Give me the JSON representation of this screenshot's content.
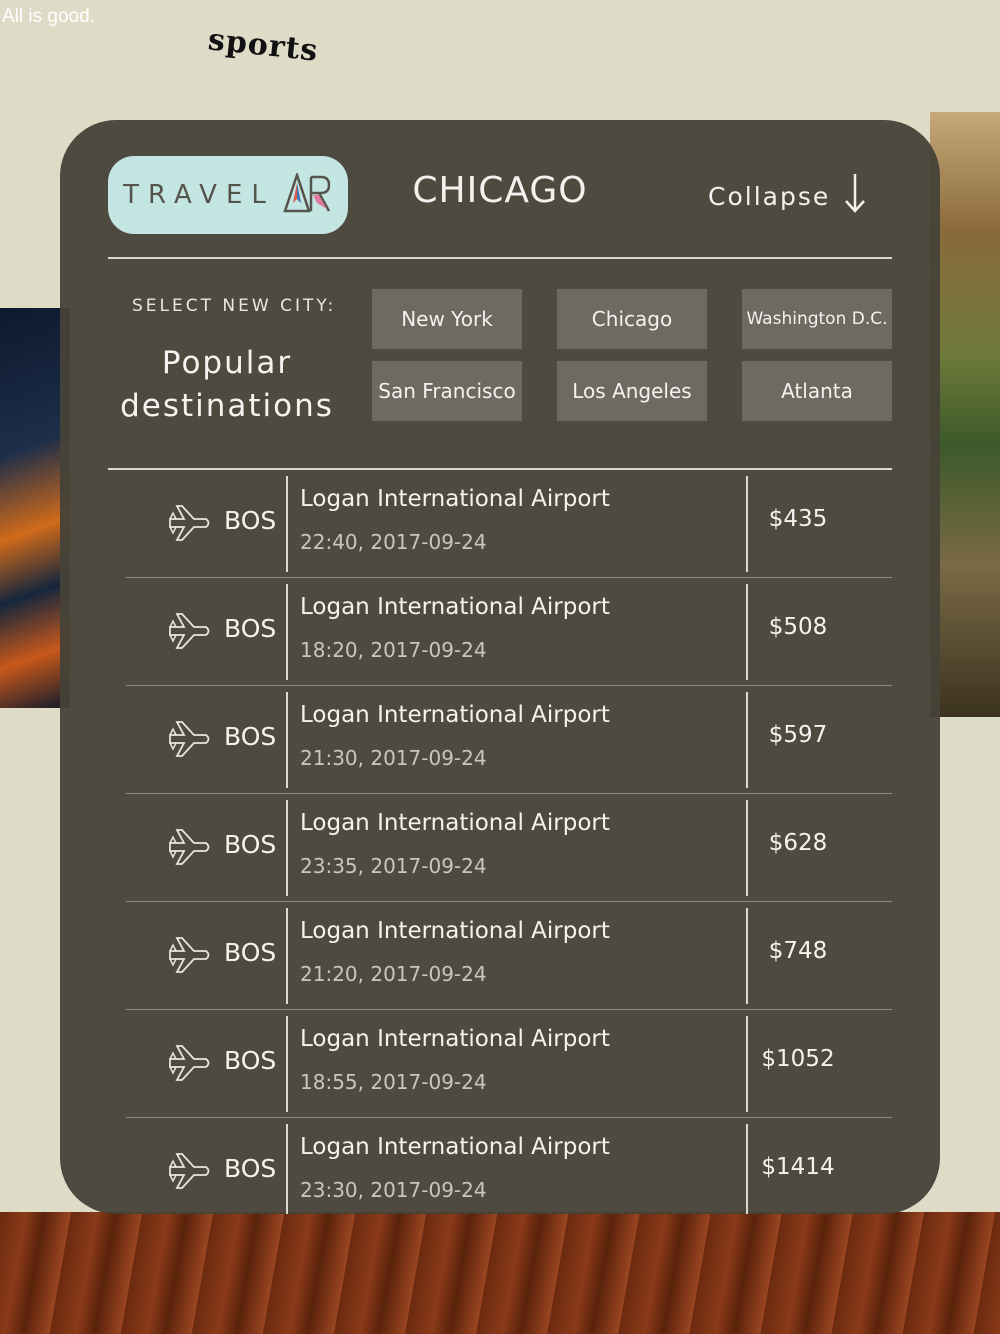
{
  "status_text": "All is good.",
  "sports_sign": "sports",
  "header": {
    "logo_text": "TRAVEL",
    "logo_ar_icon": "ar-logo-icon",
    "city": "CHICAGO",
    "collapse_label": "Collapse",
    "collapse_icon": "down-arrow-icon"
  },
  "selector": {
    "label": "SELECT NEW CITY:",
    "popular_line1": "Popular",
    "popular_line2": "destinations",
    "cities": [
      "New York",
      "Chicago",
      "Washington D.C.",
      "San Francisco",
      "Los Angeles",
      "Atlanta"
    ]
  },
  "flights": [
    {
      "code": "BOS",
      "airport": "Logan International Airport",
      "time": "22:40, 2017-09-24",
      "price": "$435"
    },
    {
      "code": "BOS",
      "airport": "Logan International Airport",
      "time": "18:20, 2017-09-24",
      "price": "$508"
    },
    {
      "code": "BOS",
      "airport": "Logan International Airport",
      "time": "21:30, 2017-09-24",
      "price": "$597"
    },
    {
      "code": "BOS",
      "airport": "Logan International Airport",
      "time": "23:35, 2017-09-24",
      "price": "$628"
    },
    {
      "code": "BOS",
      "airport": "Logan International Airport",
      "time": "21:20, 2017-09-24",
      "price": "$748"
    },
    {
      "code": "BOS",
      "airport": "Logan International Airport",
      "time": "18:55, 2017-09-24",
      "price": "$1052"
    },
    {
      "code": "BOS",
      "airport": "Logan International Airport",
      "time": "23:30, 2017-09-24",
      "price": "$1414"
    }
  ],
  "colors": {
    "panel": "#46423a",
    "logo_bg": "#c4e6e3",
    "button_bg": "#6d6a62",
    "text": "#f4f3ef"
  }
}
